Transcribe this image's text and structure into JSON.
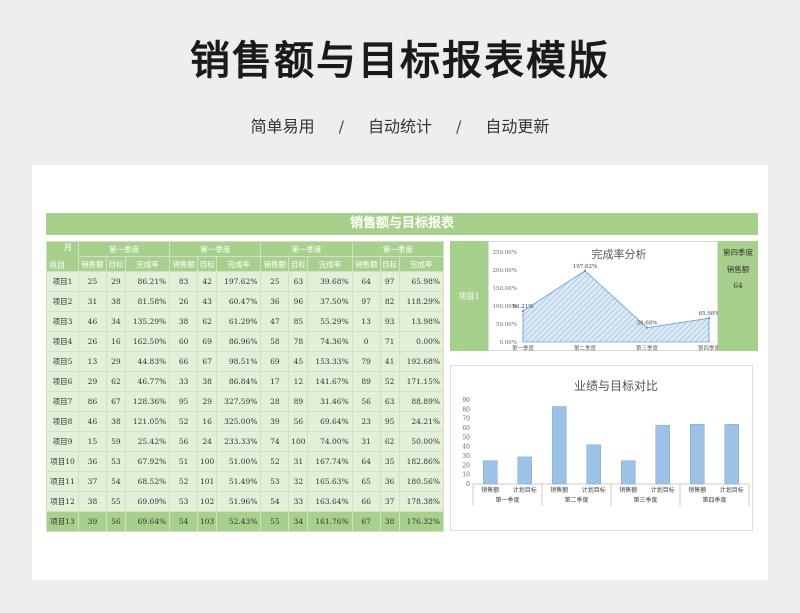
{
  "page": {
    "title": "销售额与目标报表模版",
    "tags": [
      "简单易用",
      "自动统计",
      "自动更新"
    ],
    "separator": "/"
  },
  "sheet": {
    "banner": "销售额与目标报表",
    "corner_month": "月",
    "corner_item": "项目",
    "quarters": [
      "第一季度",
      "第一季度",
      "第一季度",
      "第一季度"
    ],
    "col_headers": [
      "销售额",
      "目标",
      "完成率",
      "销售额",
      "目标",
      "完成率",
      "销售额",
      "目标",
      "完成率",
      "销售额",
      "目标",
      "完成率"
    ],
    "rows": [
      [
        "项目1",
        "25",
        "29",
        "86.21%",
        "83",
        "42",
        "197.62%",
        "25",
        "63",
        "39.68%",
        "64",
        "97",
        "65.98%"
      ],
      [
        "项目2",
        "31",
        "38",
        "81.58%",
        "26",
        "43",
        "60.47%",
        "36",
        "96",
        "37.50%",
        "97",
        "82",
        "118.29%"
      ],
      [
        "项目3",
        "46",
        "34",
        "135.29%",
        "38",
        "62",
        "61.29%",
        "47",
        "85",
        "55.29%",
        "13",
        "93",
        "13.98%"
      ],
      [
        "项目4",
        "26",
        "16",
        "162.50%",
        "60",
        "69",
        "86.96%",
        "58",
        "78",
        "74.36%",
        "0",
        "71",
        "0.00%"
      ],
      [
        "项目5",
        "13",
        "29",
        "44.83%",
        "66",
        "67",
        "98.51%",
        "69",
        "45",
        "153.33%",
        "79",
        "41",
        "192.68%"
      ],
      [
        "项目6",
        "29",
        "62",
        "46.77%",
        "33",
        "38",
        "86.84%",
        "17",
        "12",
        "141.67%",
        "89",
        "52",
        "171.15%"
      ],
      [
        "项目7",
        "86",
        "67",
        "128.36%",
        "95",
        "29",
        "327.59%",
        "28",
        "89",
        "31.46%",
        "56",
        "63",
        "88.89%"
      ],
      [
        "项目8",
        "46",
        "38",
        "121.05%",
        "52",
        "16",
        "325.00%",
        "39",
        "56",
        "69.64%",
        "23",
        "95",
        "24.21%"
      ],
      [
        "项目9",
        "15",
        "59",
        "25.42%",
        "56",
        "24",
        "233.33%",
        "74",
        "100",
        "74.00%",
        "31",
        "62",
        "50.00%"
      ],
      [
        "项目10",
        "36",
        "53",
        "67.92%",
        "51",
        "100",
        "51.00%",
        "52",
        "31",
        "167.74%",
        "64",
        "35",
        "182.86%"
      ],
      [
        "项目11",
        "37",
        "54",
        "68.52%",
        "52",
        "101",
        "51.49%",
        "53",
        "32",
        "165.63%",
        "65",
        "36",
        "180.56%"
      ],
      [
        "项目12",
        "38",
        "55",
        "69.09%",
        "53",
        "102",
        "51.96%",
        "54",
        "33",
        "163.64%",
        "66",
        "37",
        "178.38%"
      ],
      [
        "项目13",
        "39",
        "56",
        "69.64%",
        "54",
        "103",
        "52.43%",
        "55",
        "34",
        "161.76%",
        "67",
        "38",
        "176.32%"
      ]
    ],
    "selected_item": "项目1",
    "q4_label": "第四季度",
    "q4_sales_label": "销售额",
    "q4_sales_value": "64"
  },
  "colors": {
    "accent": "#a8d08d",
    "accent_light": "#e2efd9",
    "bar": "#9cc3e5",
    "area": "#9dc3e6"
  },
  "chart_data": [
    {
      "type": "area",
      "title": "完成率分析",
      "categories": [
        "第一季度",
        "第二季度",
        "第三季度",
        "第四季度"
      ],
      "values": [
        86.21,
        197.62,
        39.68,
        65.98
      ],
      "data_labels": [
        "86.21%",
        "197.62%",
        "39.68%",
        "65.98%"
      ],
      "y_ticks": [
        "0.00%",
        "50.00%",
        "100.00%",
        "150.00%",
        "200.00%",
        "250.00%"
      ],
      "ylim": [
        0,
        250
      ]
    },
    {
      "type": "bar",
      "title": "业绩与目标对比",
      "categories": [
        "销售额",
        "计划目标",
        "销售额",
        "计划目标",
        "销售额",
        "计划目标",
        "销售额",
        "计划目标"
      ],
      "groups": [
        "第一季度",
        "第二季度",
        "第三季度",
        "第四季度"
      ],
      "values": [
        25,
        29,
        83,
        42,
        25,
        63,
        64,
        64
      ],
      "y_ticks": [
        "0",
        "10",
        "20",
        "30",
        "40",
        "50",
        "60",
        "70",
        "80",
        "90"
      ],
      "ylim": [
        0,
        90
      ]
    }
  ]
}
